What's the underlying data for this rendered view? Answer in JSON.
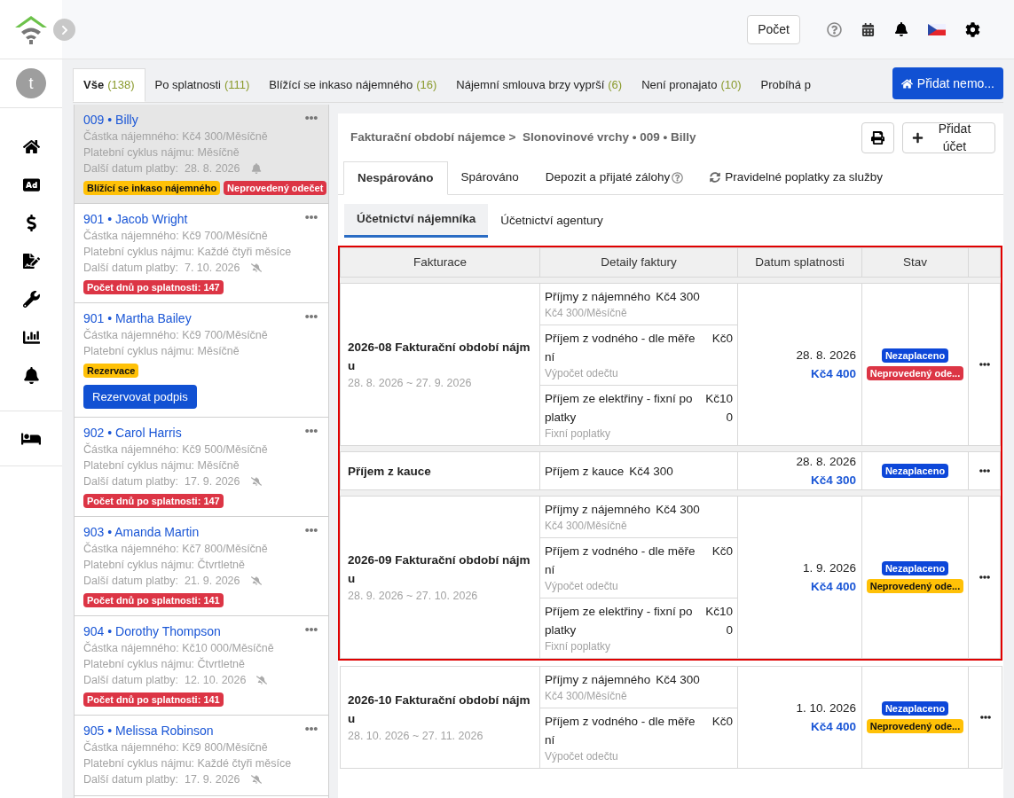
{
  "topbar": {
    "count_button": "Počet"
  },
  "sidebar": {
    "avatar": "t"
  },
  "filter_tabs": [
    {
      "label": "Vše",
      "count": "(138)",
      "selected": true
    },
    {
      "label": "Po splatnosti",
      "count": "(111)",
      "selected": false
    },
    {
      "label": "Blížící se inkaso nájemného",
      "count": "(16)",
      "selected": false
    },
    {
      "label": "Nájemní smlouva brzy vyprší",
      "count": "(6)",
      "selected": false
    },
    {
      "label": "Není pronajato",
      "count": "(10)",
      "selected": false
    },
    {
      "label": "Probíhá p",
      "selected": false
    }
  ],
  "add_property_button": "Přidat nemo...",
  "properties": [
    {
      "title": "009 • Billy",
      "rent": "Částka nájemného: Kč4 300/Měsíčně",
      "cycle": "Platební cyklus nájmu: Měsíčně",
      "next_date": "Další datum platby:  28. 8. 2026",
      "reminder": true,
      "selected": true,
      "tags": [
        {
          "text": "Blížící se inkaso nájemného",
          "color": "#ffc107"
        },
        {
          "text": "Neprovedený odečet",
          "color": "#dc3545"
        }
      ]
    },
    {
      "title": "901 • Jacob Wright",
      "rent": "Částka nájemného: Kč9 700/Měsíčně",
      "cycle": "Platební cyklus nájmu: Každé čtyři měsíce",
      "next_date": "Další datum platby:  7. 10. 2026",
      "reminder": false,
      "selected": false,
      "tags": [
        {
          "text": "Počet dnů po splatnosti: 147",
          "color": "#dc3545"
        }
      ]
    },
    {
      "title": "901 • Martha Bailey",
      "rent": "Částka nájemného: Kč9 700/Měsíčně",
      "cycle": "Platební cyklus nájmu: Měsíčně",
      "selected": false,
      "tags": [
        {
          "text": "Rezervace",
          "color": "#ffc107"
        }
      ],
      "action": "Rezervovat podpis"
    },
    {
      "title": "902 • Carol Harris",
      "rent": "Částka nájemného: Kč9 500/Měsíčně",
      "cycle": "Platební cyklus nájmu: Měsíčně",
      "next_date": "Další datum platby:  17. 9. 2026",
      "reminder": false,
      "selected": false,
      "tags": [
        {
          "text": "Počet dnů po splatnosti: 147",
          "color": "#dc3545"
        }
      ]
    },
    {
      "title": "903 • Amanda Martin",
      "rent": "Částka nájemného: Kč7 800/Měsíčně",
      "cycle": "Platební cyklus nájmu: Čtvrtletně",
      "next_date": "Další datum platby:  21. 9. 2026",
      "reminder": false,
      "selected": false,
      "tags": [
        {
          "text": "Počet dnů po splatnosti: 141",
          "color": "#dc3545"
        }
      ]
    },
    {
      "title": "904 • Dorothy Thompson",
      "rent": "Částka nájemného: Kč10 000/Měsíčně",
      "cycle": "Platební cyklus nájmu: Čtvrtletně",
      "next_date": "Další datum platby:  12. 10. 2026",
      "reminder": false,
      "selected": false,
      "tags": [
        {
          "text": "Počet dnů po splatnosti: 141",
          "color": "#dc3545"
        }
      ]
    },
    {
      "title": "905 • Melissa Robinson",
      "rent": "Částka nájemného: Kč9 800/Měsíčně",
      "cycle": "Platební cyklus nájmu: Každé čtyři měsíce",
      "next_date": "Další datum platby:  17. 9. 2026",
      "reminder": false,
      "selected": false
    }
  ],
  "detail": {
    "breadcrumb": "Fakturační období nájemce >  Slonovinové vrchy • 009 • Billy",
    "add_account_button": "Přidat účet",
    "tabs": [
      {
        "label": "Nespárováno",
        "selected": true
      },
      {
        "label": "Spárováno",
        "selected": false
      },
      {
        "label": "Depozit a přijaté zálohy",
        "selected": false,
        "kind": "help"
      },
      {
        "label": "Pravidelné poplatky za služby",
        "selected": false,
        "kind": "sync"
      }
    ],
    "subtabs": [
      {
        "label": "Účetnictví nájemníka",
        "selected": true
      },
      {
        "label": "Účetnictví agentury",
        "selected": false
      }
    ],
    "table": {
      "columns": [
        "Fakturace",
        "Detaily faktury",
        "Datum splatnosti",
        "Stav"
      ],
      "rows": [
        {
          "highlighted": true,
          "title": "2026-08 Fakturační období nájmu",
          "period": "28. 8. 2026 ~ 27. 9. 2026",
          "date": "28. 8. 2026",
          "total": "Kč4 400",
          "statuses": [
            {
              "text": "Nezaplaceno",
              "color": "#0d47d9"
            },
            {
              "text": "Neprovedený ode...",
              "color": "#dc3545"
            }
          ],
          "details": [
            {
              "kind": "inline",
              "label": "Příjmy z nájemného",
              "amount": "Kč4 300",
              "sub": "Kč4 300/Měsíčně"
            },
            {
              "kind": "split",
              "label": "Příjem z vodného - dle měření",
              "amount": "Kč0",
              "sub": "Výpočet odečtu"
            },
            {
              "kind": "split",
              "label": "Příjem ze elektřiny - fixní poplatky",
              "amount": "Kč100",
              "sub": "Fixní poplatky"
            }
          ]
        },
        {
          "highlighted": true,
          "title": "Příjem z kauce",
          "date": "28. 8. 2026",
          "total": "Kč4 300",
          "statuses": [
            {
              "text": "Nezaplaceno",
              "color": "#0d47d9"
            }
          ],
          "details": [
            {
              "kind": "inline",
              "label": "Příjem z kauce",
              "amount": "Kč4 300"
            }
          ]
        },
        {
          "highlighted": true,
          "title": "2026-09 Fakturační období nájmu",
          "period": "28. 9. 2026 ~ 27. 10. 2026",
          "date": "1. 9. 2026",
          "total": "Kč4 400",
          "statuses": [
            {
              "text": "Nezaplaceno",
              "color": "#0d47d9"
            },
            {
              "text": "Neprovedený ode...",
              "color": "#ffc107"
            }
          ],
          "details": [
            {
              "kind": "inline",
              "label": "Příjmy z nájemného",
              "amount": "Kč4 300",
              "sub": "Kč4 300/Měsíčně"
            },
            {
              "kind": "split",
              "label": "Příjem z vodného - dle měření",
              "amount": "Kč0",
              "sub": "Výpočet odečtu"
            },
            {
              "kind": "split",
              "label": "Příjem ze elektřiny - fixní poplatky",
              "amount": "Kč100",
              "sub": "Fixní poplatky"
            }
          ]
        },
        {
          "highlighted": false,
          "title": "2026-10 Fakturační období nájmu",
          "period": "28. 10. 2026 ~ 27. 11. 2026",
          "date": "1. 10. 2026",
          "total": "Kč4 400",
          "statuses": [
            {
              "text": "Nezaplaceno",
              "color": "#0d47d9"
            },
            {
              "text": "Neprovedený ode...",
              "color": "#ffc107"
            }
          ],
          "details": [
            {
              "kind": "inline",
              "label": "Příjmy z nájemného",
              "amount": "Kč4 300",
              "sub": "Kč4 300/Měsíčně"
            },
            {
              "kind": "split",
              "label": "Příjem z vodného - dle měření",
              "amount": "Kč0",
              "sub": "Výpočet odečtu"
            }
          ]
        }
      ]
    }
  }
}
